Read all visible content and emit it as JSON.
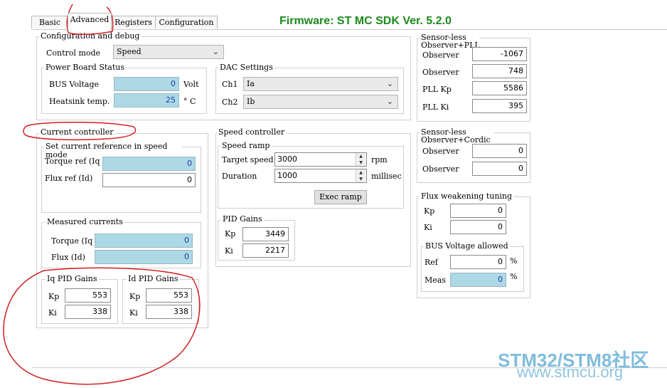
{
  "tabs": [
    {
      "label": "Basic",
      "active": false
    },
    {
      "label": "Advanced",
      "active": true
    },
    {
      "label": "Registers",
      "active": false
    },
    {
      "label": "Configuration",
      "active": false
    }
  ],
  "firmware_title": "Firmware: ST MC SDK Ver. 5.2.0",
  "config_debug": {
    "title": "Configuration and debug",
    "control_mode_label": "Control mode",
    "control_mode_value": "Speed",
    "power_board": {
      "title": "Power Board Status",
      "bus_voltage_label": "BUS Voltage",
      "bus_voltage_value": "0",
      "bus_voltage_unit": "Volt",
      "heatsink_label": "Heatsink temp.",
      "heatsink_value": "25",
      "heatsink_unit": "° C"
    },
    "dac": {
      "title": "DAC Settings",
      "ch1_label": "Ch1",
      "ch1_value": "Ia",
      "ch2_label": "Ch2",
      "ch2_value": "Ib"
    }
  },
  "current_controller": {
    "title": "Current controller",
    "set_ref": {
      "title": "Set current reference in speed mode",
      "torque_label": "Torque ref (Iq",
      "torque_value": "0",
      "flux_label": "Flux ref (Id)",
      "flux_value": "0"
    },
    "measured": {
      "title": "Measured currents",
      "torque_label": "Torque (Iq",
      "torque_value": "0",
      "flux_label": "Flux (Id)",
      "flux_value": "0"
    },
    "iq_pid": {
      "title": "Iq PID Gains",
      "kp_label": "Kp",
      "kp_value": "553",
      "ki_label": "Ki",
      "ki_value": "338"
    },
    "id_pid": {
      "title": "Id PID Gains",
      "kp_label": "Kp",
      "kp_value": "553",
      "ki_label": "Ki",
      "ki_value": "338"
    }
  },
  "speed_controller": {
    "title": "Speed controller",
    "ramp": {
      "title": "Speed ramp",
      "target_label": "Target speed",
      "target_value": "3000",
      "target_unit": "rpm",
      "duration_label": "Duration",
      "duration_value": "1000",
      "duration_unit": "millisec",
      "exec_label": "Exec ramp"
    },
    "pid": {
      "title": "PID Gains",
      "kp_label": "Kp",
      "kp_value": "3449",
      "ki_label": "Ki",
      "ki_value": "2217"
    }
  },
  "sensorless_pll": {
    "title": "Sensor-less Observer+PLL",
    "observer1_label": "Observer",
    "observer1_value": "-1067",
    "observer2_label": "Observer",
    "observer2_value": "748",
    "pll_kp_label": "PLL Kp",
    "pll_kp_value": "5586",
    "pll_ki_label": "PLL Ki",
    "pll_ki_value": "395"
  },
  "sensorless_cordic": {
    "title": "Sensor-less Observer+Cordic",
    "observer1_label": "Observer",
    "observer1_value": "0",
    "observer2_label": "Observer",
    "observer2_value": "0"
  },
  "flux_weakening": {
    "title": "Flux weakening tuning",
    "kp_label": "Kp",
    "kp_value": "0",
    "ki_label": "Ki",
    "ki_value": "0",
    "bus_allowed": {
      "title": "BUS Voltage allowed",
      "ref_label": "Ref",
      "ref_value": "0",
      "ref_unit": "%",
      "meas_label": "Meas",
      "meas_value": "0",
      "meas_unit": "%"
    }
  },
  "watermark": {
    "line1": "STM32/STM8社区",
    "line2": "www.stmcu.org"
  },
  "colors": {
    "readonly_field": "#add8e6",
    "firmware_text": "#1a8a1a",
    "annotation": "#d32020",
    "watermark": "#7fbcdc"
  }
}
